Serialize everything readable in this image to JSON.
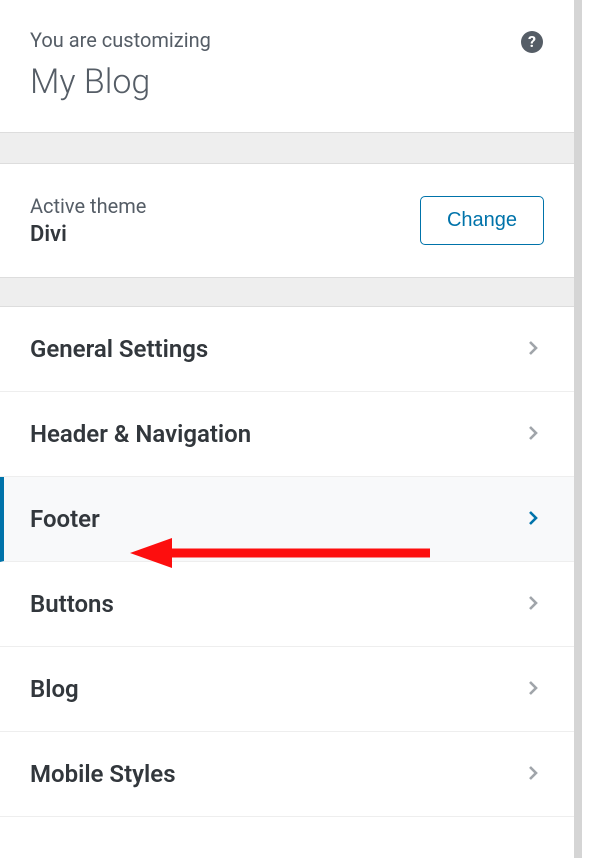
{
  "header": {
    "customizing_label": "You are customizing",
    "site_title": "My Blog"
  },
  "theme": {
    "label": "Active theme",
    "name": "Divi",
    "change_button": "Change"
  },
  "menu": {
    "items": [
      {
        "label": "General Settings",
        "highlighted": false
      },
      {
        "label": "Header & Navigation",
        "highlighted": false
      },
      {
        "label": "Footer",
        "highlighted": true
      },
      {
        "label": "Buttons",
        "highlighted": false
      },
      {
        "label": "Blog",
        "highlighted": false
      },
      {
        "label": "Mobile Styles",
        "highlighted": false
      }
    ]
  },
  "colors": {
    "accent": "#0073aa",
    "text_dark": "#32373c",
    "text_muted": "#555d66",
    "chevron_gray": "#a0a5aa",
    "annotation_red": "#fd0e0e"
  }
}
